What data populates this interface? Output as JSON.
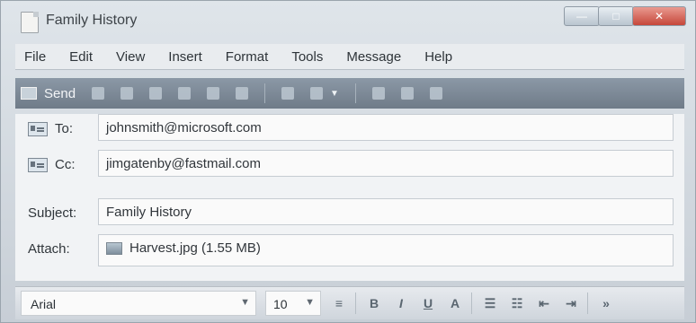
{
  "window": {
    "title": "Family History"
  },
  "menu": {
    "items": [
      "File",
      "Edit",
      "View",
      "Insert",
      "Format",
      "Tools",
      "Message",
      "Help"
    ]
  },
  "toolbar": {
    "send_label": "Send"
  },
  "fields": {
    "to_label": "To:",
    "to_value": "johnsmith@microsoft.com",
    "cc_label": "Cc:",
    "cc_value": "jimgatenby@fastmail.com",
    "subject_label": "Subject:",
    "subject_value": "Family History",
    "attach_label": "Attach:",
    "attachment": "Harvest.jpg (1.55 MB)"
  },
  "formatting": {
    "font": "Arial",
    "size": "10",
    "bold": "B",
    "italic": "I",
    "underline": "U",
    "more": "»"
  },
  "icons": [
    "send-icon",
    "cut-icon",
    "copy-icon",
    "paste-icon",
    "undo-icon",
    "check-names-icon",
    "spelling-icon",
    "attach-icon",
    "priority-icon",
    "sign-icon",
    "encrypt-icon",
    "offline-icon",
    "address-book-icon",
    "file-icon",
    "align-icon",
    "numbered-list-icon",
    "bulleted-list-icon",
    "decrease-indent-icon",
    "increase-indent-icon"
  ],
  "colors": {
    "toolbar": "#7f8b98",
    "close_button": "#d05d4f"
  }
}
